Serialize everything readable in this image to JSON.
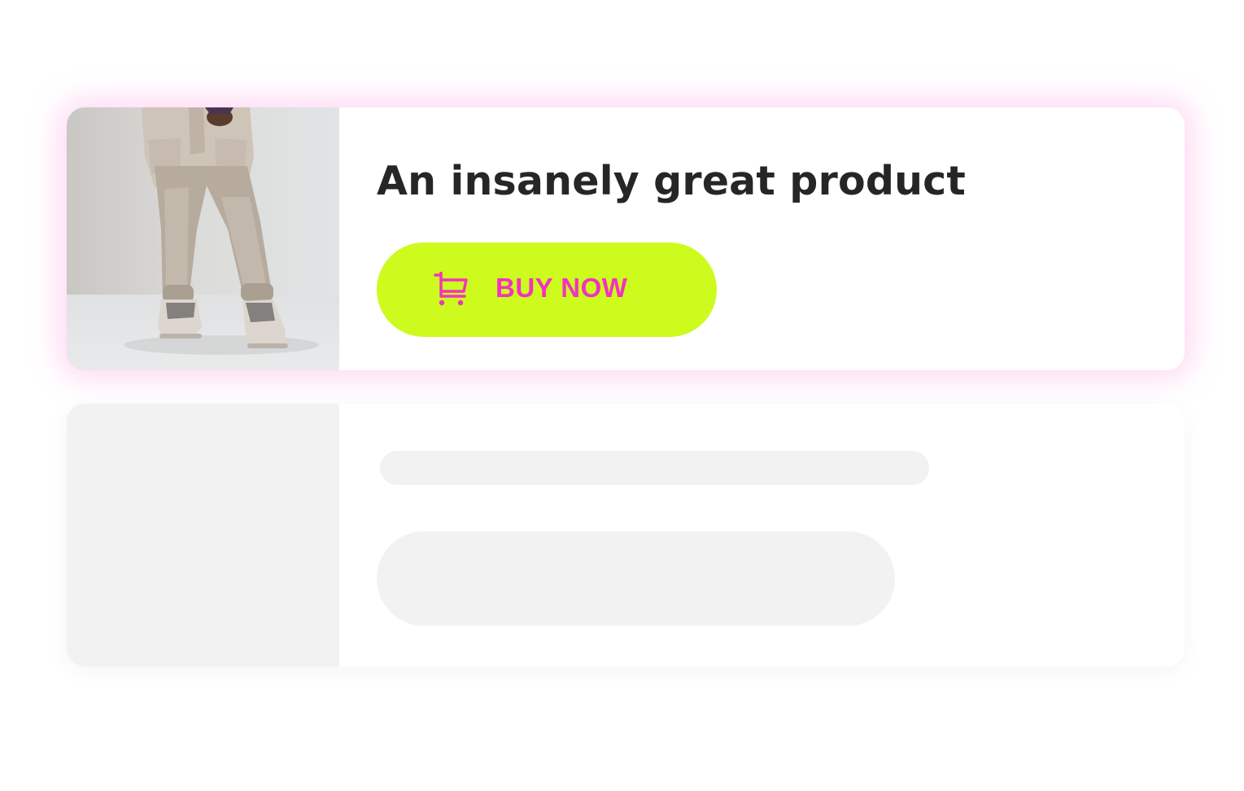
{
  "product": {
    "title": "An insanely great product",
    "image_icon": "product-photo-person-in-beige-outfit",
    "buy_button": {
      "label": "BUY NOW",
      "icon": "cart-icon",
      "background_color": "#ccfb1d",
      "text_color": "#f233bd"
    }
  },
  "placeholder_card": {
    "state": "loading-skeleton"
  },
  "colors": {
    "card_glow": "#ff96e1",
    "skeleton": "#f2f2f2",
    "title_text": "#262626"
  }
}
